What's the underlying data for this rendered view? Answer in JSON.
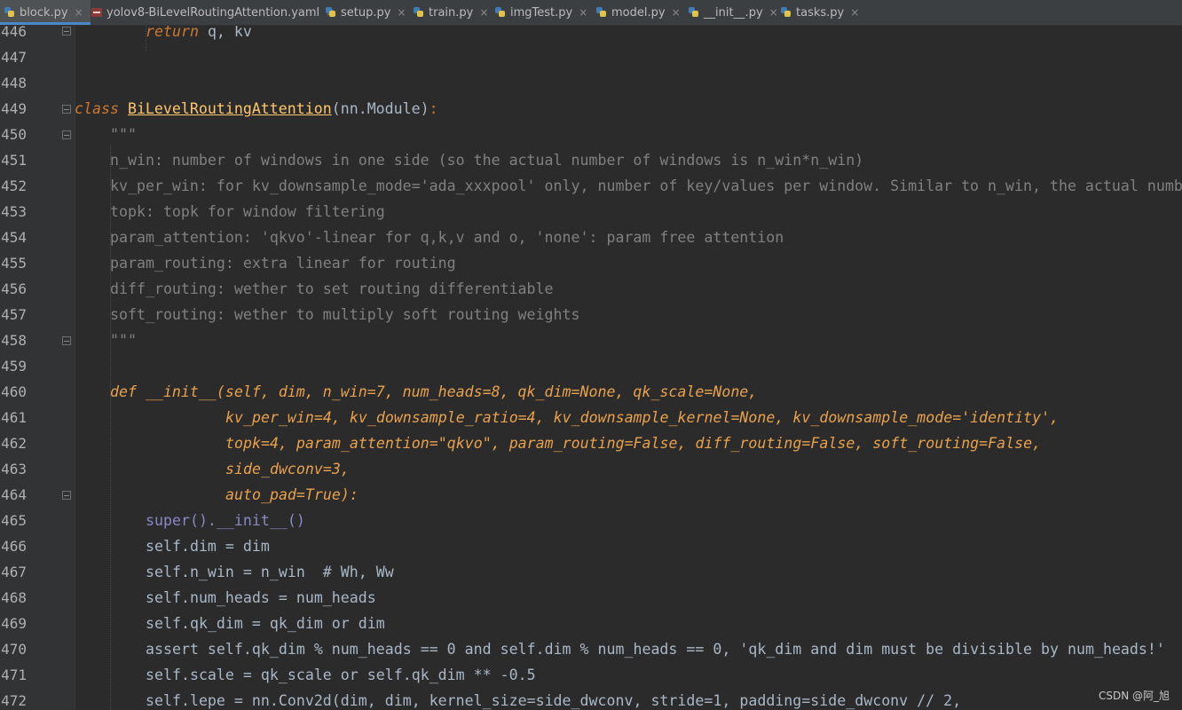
{
  "tabs": [
    {
      "label": "block.py",
      "icon": "python-file-icon",
      "active": true
    },
    {
      "label": "yolov8-BiLevelRoutingAttention.yaml",
      "icon": "yaml-file-icon",
      "active": false
    },
    {
      "label": "setup.py",
      "icon": "python-file-icon",
      "active": false
    },
    {
      "label": "train.py",
      "icon": "python-file-icon",
      "active": false
    },
    {
      "label": "imgTest.py",
      "icon": "python-file-icon",
      "active": false
    },
    {
      "label": "model.py",
      "icon": "python-file-icon",
      "active": false
    },
    {
      "label": "__init__.py",
      "icon": "python-file-icon",
      "active": false
    },
    {
      "label": "tasks.py",
      "icon": "python-file-icon",
      "active": false
    }
  ],
  "tab_close_glyph": "×",
  "line_numbers": [
    "446",
    "447",
    "448",
    "449",
    "450",
    "451",
    "452",
    "453",
    "454",
    "455",
    "456",
    "457",
    "458",
    "459",
    "460",
    "461",
    "462",
    "463",
    "464",
    "465",
    "466",
    "467",
    "468",
    "469",
    "470",
    "471",
    "472"
  ],
  "code": {
    "l446": {
      "kw": "return",
      "rest": " q, kv"
    },
    "l449": {
      "kw": "class",
      "name": "BiLevelRoutingAttention",
      "base": "(nn.Module)",
      "colon": ":"
    },
    "l450": "\"\"\"",
    "l451": "n_win: number of windows in one side (so the actual number of windows is n_win*n_win)",
    "l452": "kv_per_win: for kv_downsample_mode='ada_xxxpool' only, number of key/values per window. Similar to n_win, the actual numb",
    "l453": "topk: topk for window filtering",
    "l454": "param_attention: 'qkvo'-linear for q,k,v and o, 'none': param free attention",
    "l455": "param_routing: extra linear for routing",
    "l456": "diff_routing: wether to set routing differentiable",
    "l457": "soft_routing: wether to multiply soft routing weights",
    "l458": "\"\"\"",
    "l460": "def __init__(self, dim, n_win=7, num_heads=8, qk_dim=None, qk_scale=None,",
    "l461": "kv_per_win=4, kv_downsample_ratio=4, kv_downsample_kernel=None, kv_downsample_mode='identity',",
    "l462": "topk=4, param_attention=\"qkvo\", param_routing=False, diff_routing=False, soft_routing=False,",
    "l463": "side_dwconv=3,",
    "l464": "auto_pad=True):",
    "l465": "super().__init__()",
    "l466": "self.dim = dim",
    "l467": "self.n_win = n_win  # Wh, Ww",
    "l468": "self.num_heads = num_heads",
    "l469": "self.qk_dim = qk_dim or dim",
    "l470": "assert self.qk_dim % num_heads == 0 and self.dim % num_heads == 0, 'qk_dim and dim must be divisible by num_heads!'",
    "l471": "self.scale = qk_scale or self.qk_dim ** -0.5",
    "l472": "self.lepe = nn.Conv2d(dim, dim, kernel_size=side_dwconv, stride=1, padding=side_dwconv // 2,"
  },
  "watermark": "CSDN @阿_旭",
  "colors": {
    "background": "#2b2b2b",
    "gutter": "#313335",
    "tabbar": "#3c3f41",
    "keyword": "#cc7832",
    "string": "#6a8759",
    "number": "#6897bb",
    "self": "#94558d",
    "docstring": "#808080"
  }
}
